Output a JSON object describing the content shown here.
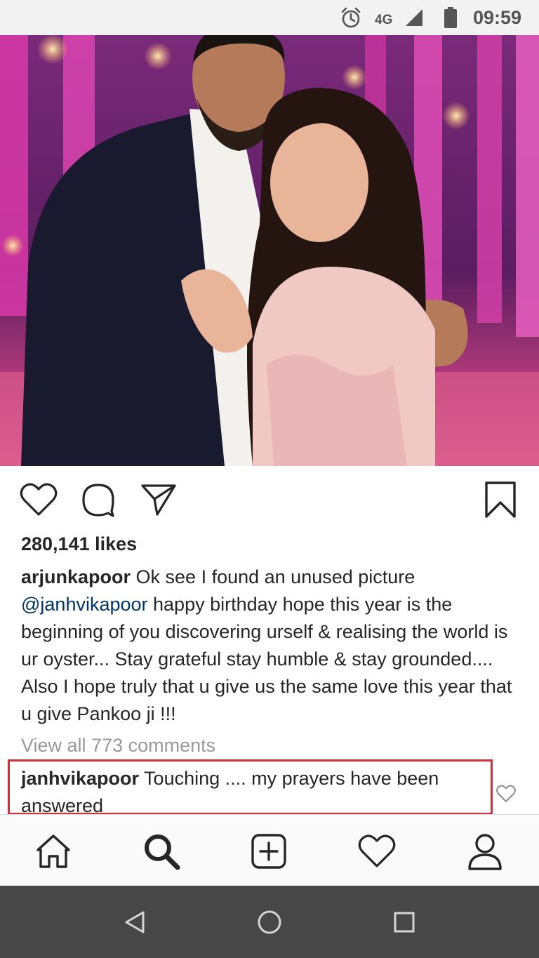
{
  "status_bar": {
    "network": "4G",
    "time": "09:59",
    "icons": [
      "alarm-icon",
      "signal-icon",
      "battery-icon"
    ]
  },
  "post": {
    "photo": "post-photo",
    "likes": "280,141 likes",
    "caption": {
      "username": "arjunkapoor",
      "text_before_mention": " Ok see I found an unused picture ",
      "mention": "@janhvikapoor",
      "text_after_mention": " happy birthday hope this year is the beginning of you discovering urself & realising the world is ur oyster... Stay grateful stay humble & stay grounded.... Also I hope truly that u give us the same love this year that u give Pankoo ji !!!"
    },
    "view_comments": "View all 773 comments",
    "comment": {
      "username": "janhvikapoor",
      "text": " Touching .... my prayers have been answered"
    },
    "actions": [
      "heart-icon",
      "comment-icon",
      "share-icon",
      "bookmark-icon"
    ]
  },
  "bottom_nav": [
    "home-icon",
    "search-icon",
    "add-post-icon",
    "activity-heart-icon",
    "profile-icon"
  ],
  "android_nav": [
    "back-icon",
    "home-circle-icon",
    "recents-icon"
  ],
  "colors": {
    "mention": "#003569",
    "highlight_border": "#d22f3b",
    "muted_text": "#999999"
  }
}
